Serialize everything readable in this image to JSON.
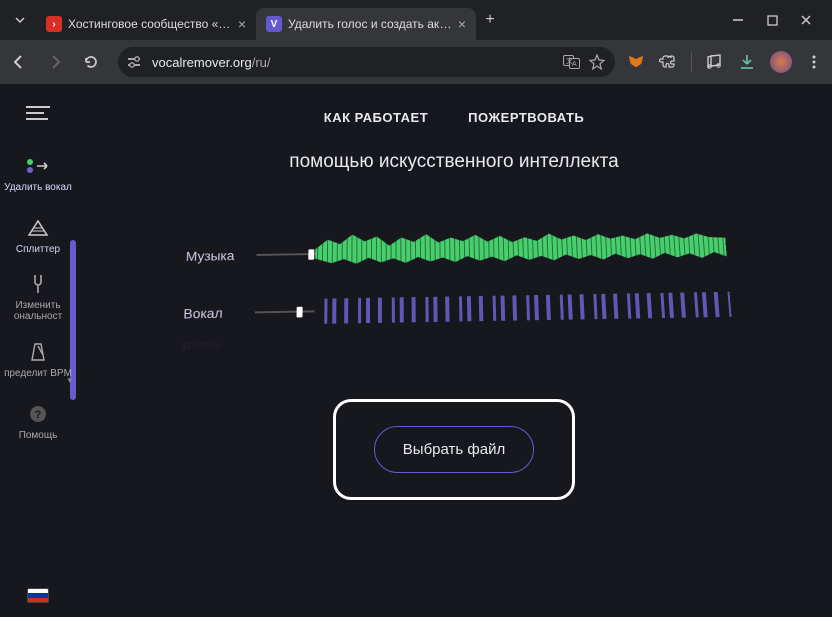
{
  "browser": {
    "tabs": [
      {
        "title": "Хостинговое сообщество «Tim",
        "favicon": "red"
      },
      {
        "title": "Удалить голос и создать акапе",
        "favicon": "violet"
      }
    ],
    "address": {
      "domain": "vocalremover.org",
      "path": "/ru/"
    }
  },
  "topnav": {
    "how": "КАК РАБОТАЕТ",
    "donate": "ПОЖЕРТВОВАТЬ"
  },
  "headline": "помощью искусственного интеллекта",
  "tracks": {
    "music": {
      "label": "Музыка",
      "slider": 0.88
    },
    "vocal": {
      "label": "Вокал",
      "slider": 0.7
    },
    "reflection_label": "Вокал"
  },
  "cta": {
    "label": "Выбрать файл"
  },
  "sidebar": {
    "items": [
      {
        "id": "remove",
        "label": "Удалить вокал"
      },
      {
        "id": "splitter",
        "label": "Сплиттер"
      },
      {
        "id": "pitch",
        "label": "Изменить ональност"
      },
      {
        "id": "bpm",
        "label": "пределит BPM"
      },
      {
        "id": "help",
        "label": "Помощь"
      }
    ]
  }
}
